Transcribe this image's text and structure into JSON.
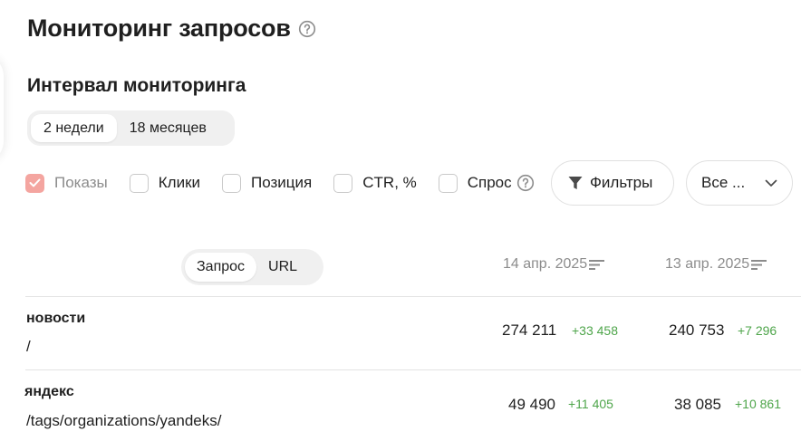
{
  "header": {
    "title": "Мониторинг запросов",
    "help_icon": "question-circle-icon"
  },
  "interval": {
    "title": "Интервал мониторинга",
    "options": [
      "2 недели",
      "18 месяцев"
    ],
    "selected": "2 недели"
  },
  "metrics": [
    {
      "label": "Показы",
      "checked": true,
      "disabled": true
    },
    {
      "label": "Клики",
      "checked": false
    },
    {
      "label": "Позиция",
      "checked": false
    },
    {
      "label": "CTR, %",
      "checked": false
    },
    {
      "label": "Спрос",
      "checked": false,
      "help_icon": "question-circle-icon"
    }
  ],
  "filters_button": {
    "label": "Фильтры",
    "icon": "funnel-icon"
  },
  "group_select": {
    "value": "Все ...",
    "icon": "chevron-down-icon"
  },
  "view_toggle": {
    "options": [
      "Запрос",
      "URL"
    ],
    "selected": "Запрос"
  },
  "columns": [
    {
      "label": "14 апр. 2025",
      "icon": "sort-icon"
    },
    {
      "label": "13 апр. 2025",
      "icon": "sort-icon"
    }
  ],
  "rows": [
    {
      "query": "новости",
      "url": "/",
      "values": [
        {
          "value": "274 211",
          "delta": "+33 458"
        },
        {
          "value": "240 753",
          "delta": "+7 296"
        }
      ]
    },
    {
      "query": "яндекс",
      "url": "/tags/organizations/yandeks/",
      "values": [
        {
          "value": "49 490",
          "delta": "+11 405"
        },
        {
          "value": "38 085",
          "delta": "+10 861"
        }
      ]
    }
  ],
  "colors": {
    "accent_check": "#f4a5a0",
    "delta_positive": "#4ea54a",
    "muted_text": "#8c8c8c"
  }
}
